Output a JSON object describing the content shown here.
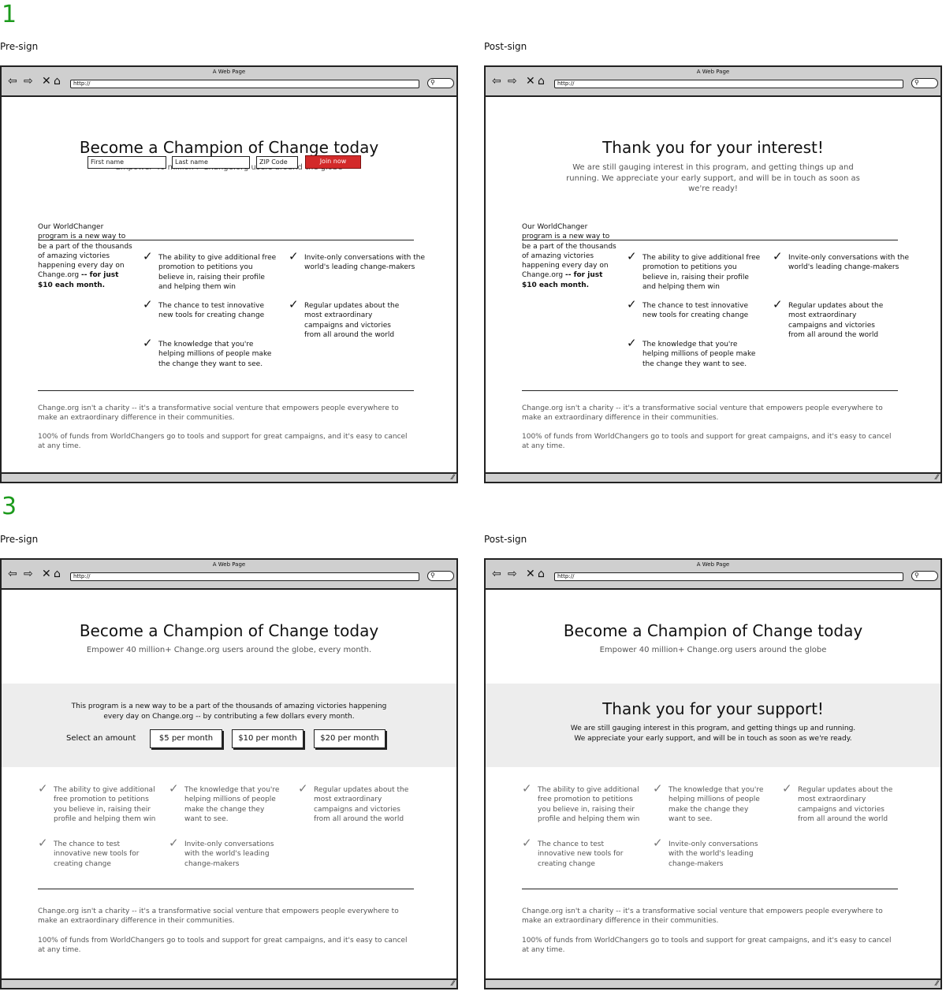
{
  "section1": {
    "number": "1",
    "pre_label": "Pre-sign",
    "post_label": "Post-sign"
  },
  "section3": {
    "number": "3",
    "pre_label": "Pre-sign",
    "post_label": "Post-sign"
  },
  "browser": {
    "window_title": "A Web Page",
    "url": "http://",
    "search_icon": "search-icon",
    "back_icon": "back-arrow-icon",
    "forward_icon": "forward-arrow-icon",
    "stop_icon": "close-icon",
    "home_icon": "home-icon"
  },
  "v1": {
    "title": "Become a Champion of Change today",
    "subtitle": "Empower 40 million+ Change.org users around the globe",
    "first_name_placeholder": "First name",
    "last_name_placeholder": "Last name",
    "zip_placeholder": "ZIP Code",
    "join_label": "Join now",
    "join_color": "#d32a2a",
    "intro_text": "Our WorldChanger program is a new way to be a part of the thousands of amazing victories happening every day on Change.org",
    "intro_bold": "-- for just $10 each month.",
    "features": [
      "The ability to give additional free promotion to petitions you believe in, raising their profile and helping them win",
      "The chance to test innovative new tools for creating change",
      "The knowledge that you're helping millions of people make the change they want to see.",
      "Invite-only conversations with the world's leading change-makers",
      "Regular updates about the most extraordinary campaigns and victories from all around the world"
    ],
    "footer1": "Change.org isn't a charity -- it's a transformative social venture that empowers people everywhere to make an extraordinary difference in their communities.",
    "footer2": "100% of funds from WorldChangers go to tools and support for great campaigns, and it's easy to cancel at any time."
  },
  "v1_post": {
    "title": "Thank you for your interest!",
    "body": "We are still gauging interest in this program, and getting things up and running. We appreciate your early support, and will be in touch as soon as we're ready!"
  },
  "v3": {
    "title": "Become a Champion of Change today",
    "subtitle_pre": "Empower 40 million+ Change.org users around the globe, every month.",
    "subtitle_post": "Empower 40 million+ Change.org users around the globe",
    "program_text": "This program is a new way to be a part of the thousands of amazing victories happening every day on Change.org -- by contributing a few dollars every month.",
    "select_label": "Select an amount",
    "amounts": [
      "$5 per month",
      "$10 per month",
      "$20 per month"
    ],
    "features": [
      "The ability to give additional free promotion to petitions you believe in, raising their profile and helping them win",
      "The knowledge that you're helping millions of people make the change they want to see.",
      "Regular updates about the most extraordinary campaigns and victories from all around the world",
      "The chance to test innovative new tools for creating change",
      "Invite-only conversations with the world's leading change-makers"
    ],
    "thanks_title": "Thank you for your support!",
    "thanks_body": "We are still gauging interest in this program, and getting things up and running. We appreciate your early support, and will be in touch as soon as we're ready.",
    "footer1": "Change.org isn't a charity -- it's a transformative social venture that empowers people everywhere to make an extraordinary difference in their communities.",
    "footer2": "100% of funds from WorldChangers go to tools and support for great campaigns, and it's easy to cancel at any time."
  }
}
